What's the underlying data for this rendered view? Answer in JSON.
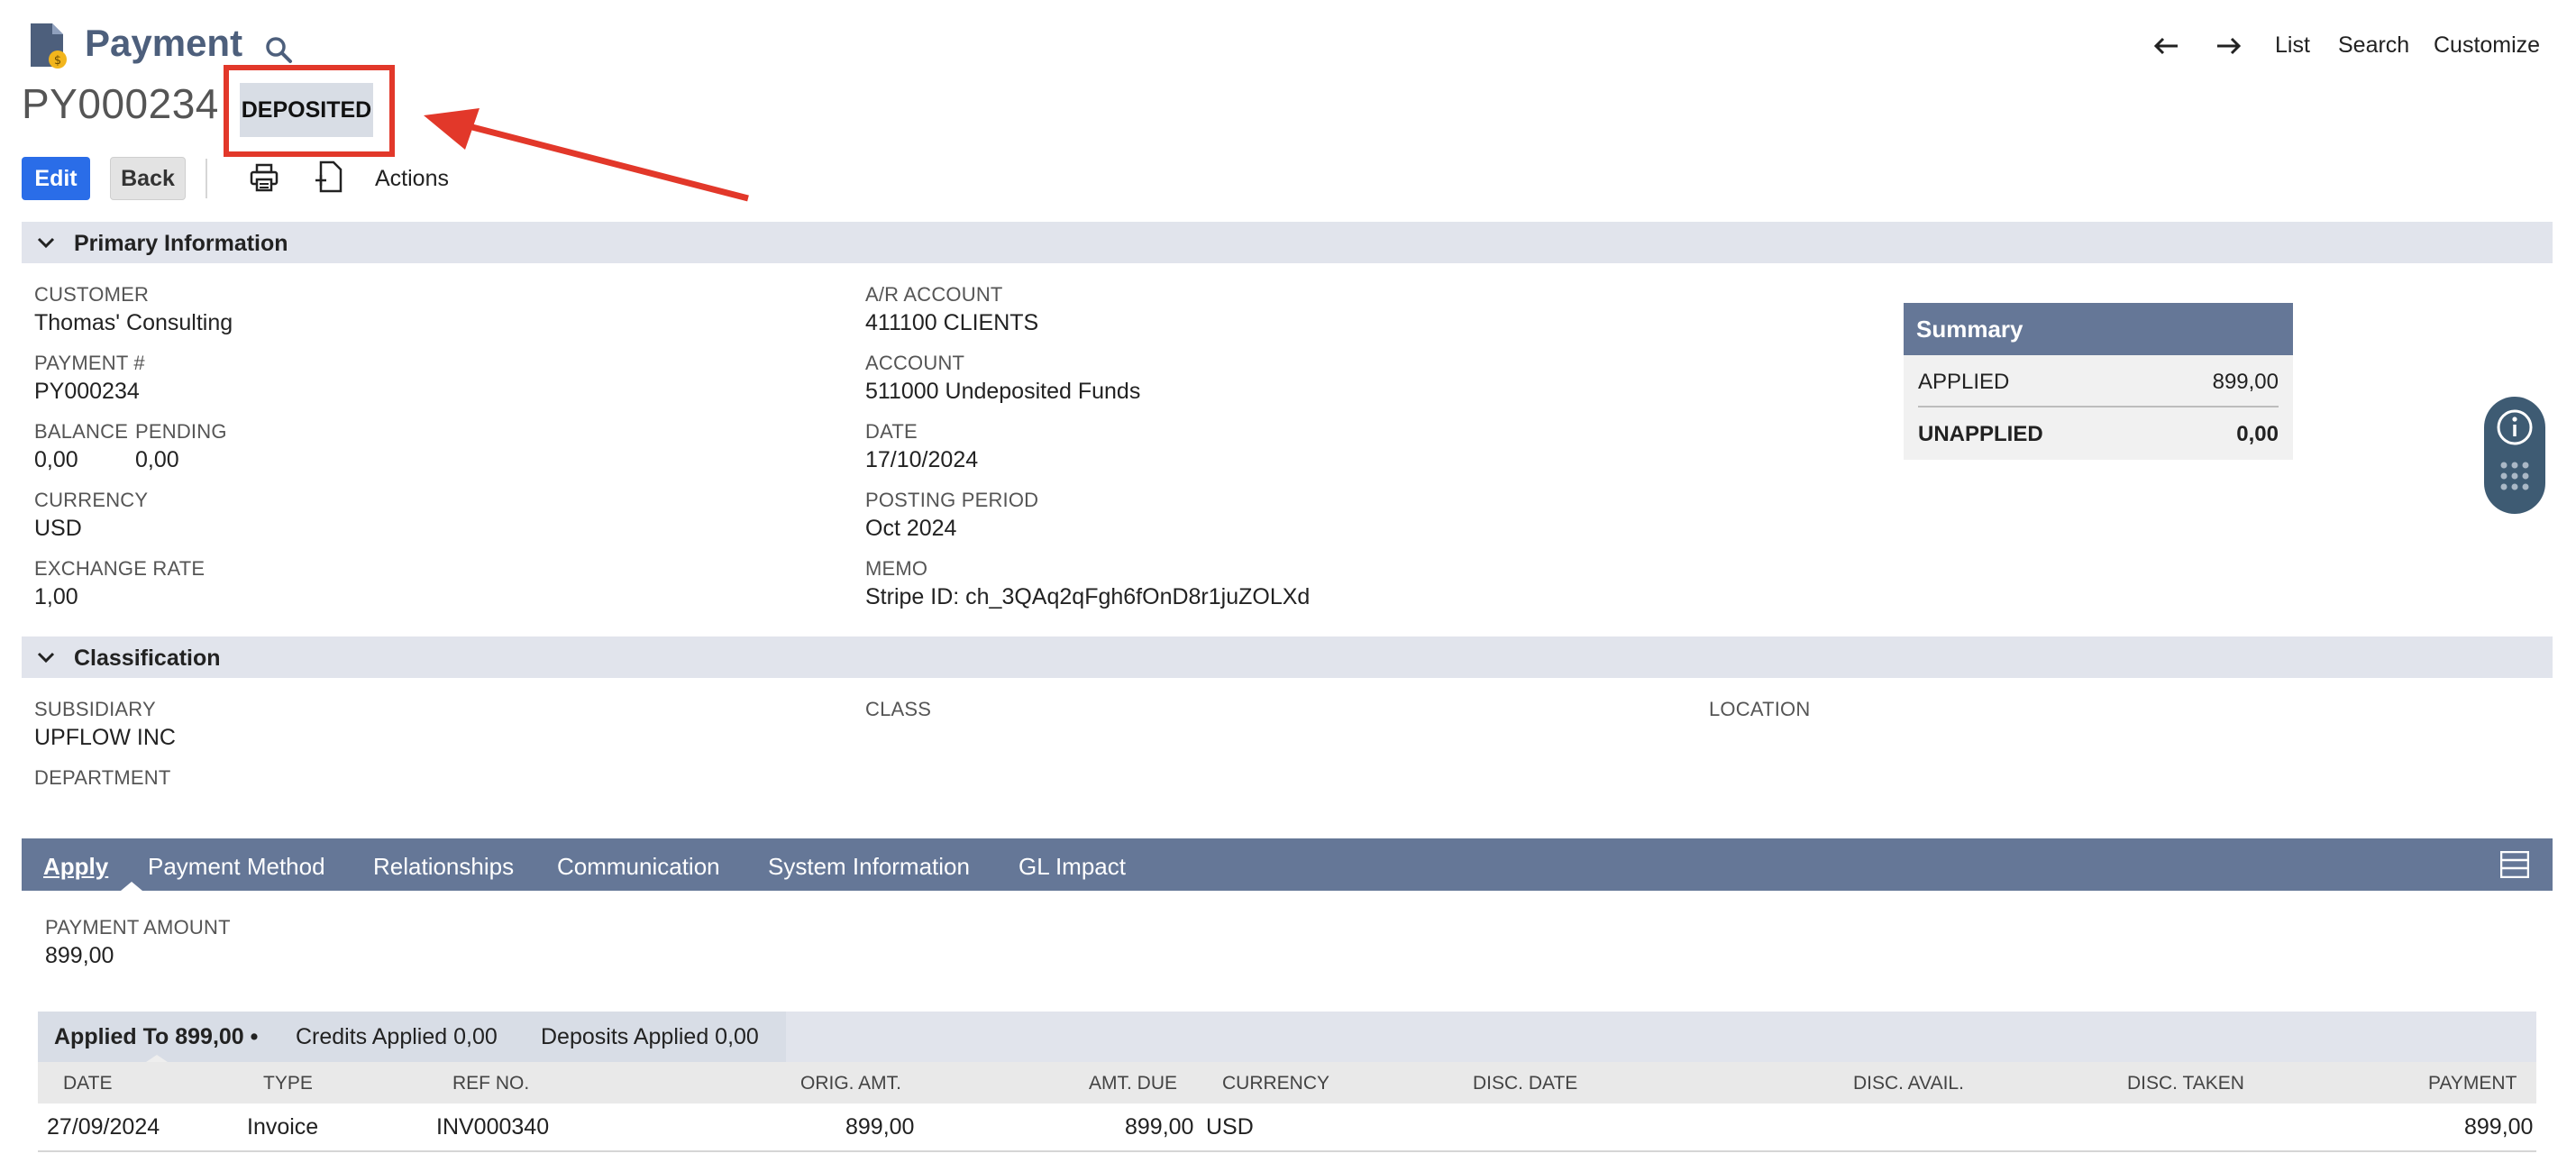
{
  "header": {
    "title": "Payment",
    "record_id": "PY000234",
    "status": "DEPOSITED",
    "nav": {
      "list": "List",
      "search": "Search",
      "customize": "Customize"
    }
  },
  "toolbar": {
    "edit": "Edit",
    "back": "Back",
    "actions": "Actions"
  },
  "primary": {
    "section_title": "Primary Information",
    "customer_label": "CUSTOMER",
    "customer": "Thomas' Consulting",
    "payment_no_label": "PAYMENT #",
    "payment_no": "PY000234",
    "balance_label": "BALANCE",
    "balance": "0,00",
    "pending_label": "PENDING",
    "pending": "0,00",
    "currency_label": "CURRENCY",
    "currency": "USD",
    "exchange_rate_label": "EXCHANGE RATE",
    "exchange_rate": "1,00",
    "ar_account_label": "A/R ACCOUNT",
    "ar_account": "411100 CLIENTS",
    "account_label": "ACCOUNT",
    "account": "511000 Undeposited Funds",
    "date_label": "DATE",
    "date": "17/10/2024",
    "posting_period_label": "POSTING PERIOD",
    "posting_period": "Oct 2024",
    "memo_label": "MEMO",
    "memo": "Stripe ID: ch_3QAq2qFgh6fOnD8r1juZOLXd"
  },
  "summary": {
    "title": "Summary",
    "applied_label": "APPLIED",
    "applied": "899,00",
    "unapplied_label": "UNAPPLIED",
    "unapplied": "0,00"
  },
  "classification": {
    "section_title": "Classification",
    "subsidiary_label": "SUBSIDIARY",
    "subsidiary": "UPFLOW INC",
    "department_label": "DEPARTMENT",
    "class_label": "CLASS",
    "location_label": "LOCATION"
  },
  "tabs": [
    "Apply",
    "Payment Method",
    "Relationships",
    "Communication",
    "System Information",
    "GL Impact"
  ],
  "apply": {
    "payment_amount_label": "PAYMENT AMOUNT",
    "payment_amount": "899,00",
    "subtabs": [
      "Applied To 899,00 •",
      "Credits Applied 0,00",
      "Deposits Applied 0,00"
    ],
    "columns": [
      "DATE",
      "TYPE",
      "REF NO.",
      "ORIG. AMT.",
      "AMT. DUE",
      "CURRENCY",
      "DISC. DATE",
      "DISC. AVAIL.",
      "DISC. TAKEN",
      "PAYMENT"
    ],
    "rows": [
      {
        "date": "27/09/2024",
        "type": "Invoice",
        "ref": "INV000340",
        "orig": "899,00",
        "due": "899,00",
        "currency": "USD",
        "payment": "899,00"
      }
    ]
  },
  "colors": {
    "accent": "#2a6de8",
    "tabbar": "#657797",
    "annotation": "#e2382a"
  }
}
